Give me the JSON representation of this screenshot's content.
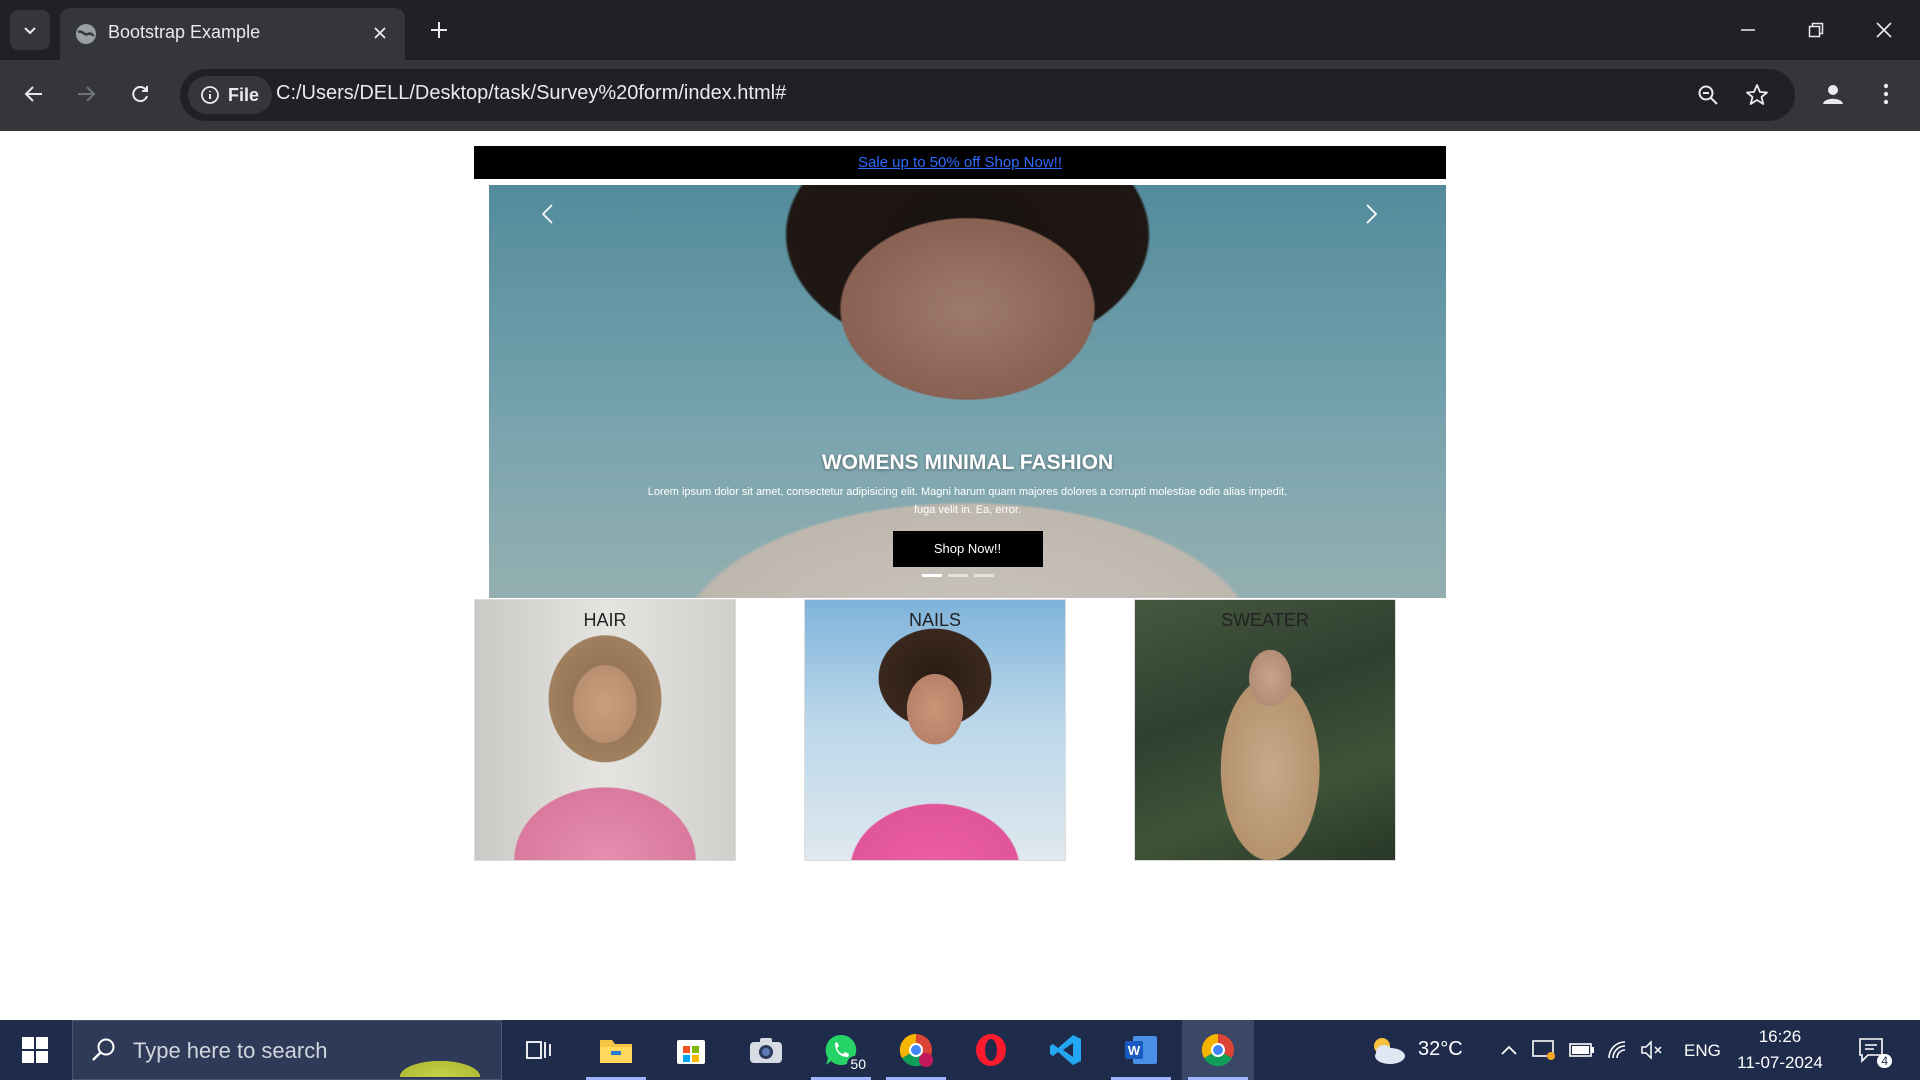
{
  "browser": {
    "tab_title": "Bootstrap Example",
    "site_info_label": "File",
    "url": "C:/Users/DELL/Desktop/task/Survey%20form/index.html#"
  },
  "page": {
    "banner_link": "Sale up to 50% off Shop Now!!",
    "carousel": {
      "title": "WOMENS MINIMAL FASHION",
      "text": "Lorem ipsum dolor sit amet, consectetur adipisicing elit. Magni harum quam majores dolores a corrupti molestiae odio alias impedit, fuga velit in. Ea, error.",
      "button": "Shop Now!!",
      "slide_count": 3,
      "active_slide": 1
    },
    "cards": [
      {
        "label": "HAIR"
      },
      {
        "label": "NAILS"
      },
      {
        "label": "SWEATER"
      }
    ]
  },
  "taskbar": {
    "search_placeholder": "Type here to search",
    "whatsapp_badge": "50",
    "weather": "32°C",
    "language": "ENG",
    "time": "16:26",
    "date": "11-07-2024",
    "notifications": "4"
  },
  "icons": [
    "tab-list-icon",
    "globe-icon",
    "close-icon",
    "plus-icon",
    "minimize-icon",
    "restore-icon",
    "back-icon",
    "forward-icon",
    "reload-icon",
    "info-icon",
    "zoom-icon",
    "star-icon",
    "profile-icon",
    "more-icon",
    "windows-icon",
    "search-icon",
    "task-view-icon",
    "file-explorer-icon",
    "store-icon",
    "camera-icon",
    "whatsapp-icon",
    "chrome-icon",
    "opera-icon",
    "vscode-icon",
    "word-icon",
    "weather-icon",
    "chevron-up-icon",
    "notification-icon"
  ],
  "colors": {
    "chrome_dark": "#202124",
    "chrome_toolbar": "#35363a",
    "banner_bg": "#000000",
    "banner_link": "#2d6bff",
    "taskbar": "#1f2b4a"
  }
}
